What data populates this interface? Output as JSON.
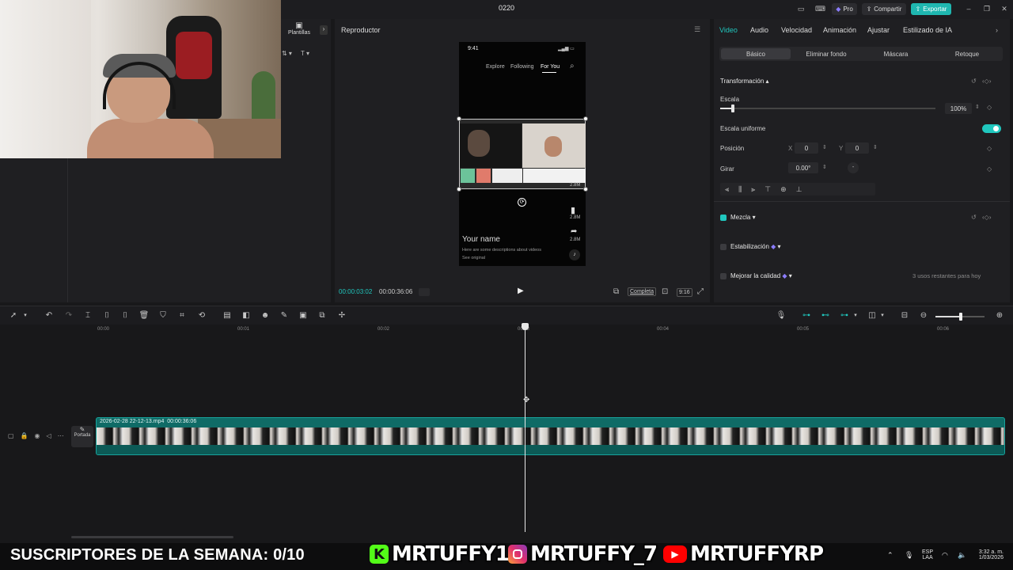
{
  "window": {
    "title": "0220"
  },
  "titlebar": {
    "pro_label": "Pro",
    "share_label": "Compartir",
    "export_label": "Exportar"
  },
  "left_panel": {
    "templates_label": "Plantillas"
  },
  "player": {
    "header": "Reproductor",
    "current_time": "00:00:03:02",
    "total_time": "00:00:36:06",
    "complete_label": "Completa",
    "ratio_label": "9:16",
    "phone": {
      "time": "9:41",
      "tabs": [
        "Explore",
        "Following",
        "For You"
      ],
      "name": "Your name",
      "description": "Here are some descriptions about videos",
      "see_original": "See original",
      "counts": [
        "2.8M",
        "2.8M",
        "2.8M"
      ]
    }
  },
  "props": {
    "tabs": [
      "Video",
      "Audio",
      "Velocidad",
      "Animación",
      "Ajustar",
      "Estilizado de IA"
    ],
    "subtabs": [
      "Básico",
      "Eliminar fondo",
      "Máscara",
      "Retoque"
    ],
    "transform_label": "Transformación",
    "scale_label": "Escala",
    "scale_value": "100%",
    "scale_level": 0.06,
    "uniform_label": "Escala uniforme",
    "position_label": "Posición",
    "pos_x_label": "X",
    "pos_x": "0",
    "pos_y_label": "Y",
    "pos_y": "0",
    "rotate_label": "Girar",
    "rotate_value": "0.00°",
    "blend_label": "Mezcla",
    "stabilize_label": "Estabilización",
    "quality_label": "Mejorar la calidad",
    "quality_note": "3 usos restantes para hoy"
  },
  "timeline": {
    "ticks": [
      "00:00",
      "00:01",
      "00:02",
      "00:03",
      "00:04",
      "00:05",
      "00:06"
    ],
    "clip_name": "2026-02-28 22-12-13.mp4",
    "clip_duration": "00:00:36:06",
    "cover_label": "Portada"
  },
  "overlay": {
    "subscribers": "SUSCRIPTORES DE LA SEMANA: 0/10",
    "kick_handle": "MRTUFFY1",
    "instagram_handle": "MRTUFFY_7",
    "youtube_handle": "MRTUFFYRP",
    "kick_badge": "K"
  },
  "tray": {
    "lang": "ESP",
    "layout": "LAA",
    "time": "3:32 a. m.",
    "date": "1/03/2026"
  },
  "colors": {
    "accent": "#20c7be",
    "export": "#1fb7b0",
    "clip": "#0f6b66",
    "kick": "#53fc18",
    "youtube": "#ff0000"
  }
}
